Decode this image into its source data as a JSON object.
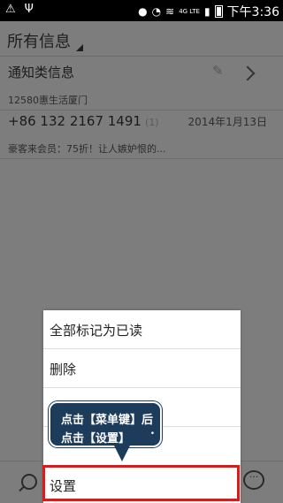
{
  "status_bar": {
    "network": "4G LTE",
    "time": "下午3:36",
    "icons": [
      "usb-icon",
      "notification-icon",
      "mute-icon",
      "wifi-icon",
      "signal-icon",
      "battery-icon"
    ]
  },
  "header": {
    "title": "所有信息"
  },
  "messages": [
    {
      "title": "通知类信息",
      "subtitle": "12580惠生活厦门"
    },
    {
      "title": "+86 132 2167 1491",
      "count": "(1)",
      "date": "2014年1月13日",
      "preview": "豪客来会员：75折！让人嫉妒恨的..."
    }
  ],
  "menu": {
    "items": [
      "全部标记为已读",
      "删除",
      "",
      "",
      "设置"
    ]
  },
  "callout": {
    "line1": "点击【菜单键】后",
    "line2": "点击【设置】",
    "dot": "•"
  },
  "colors": {
    "highlight": "#e01818",
    "callout_bg": "#1d3b5a"
  }
}
